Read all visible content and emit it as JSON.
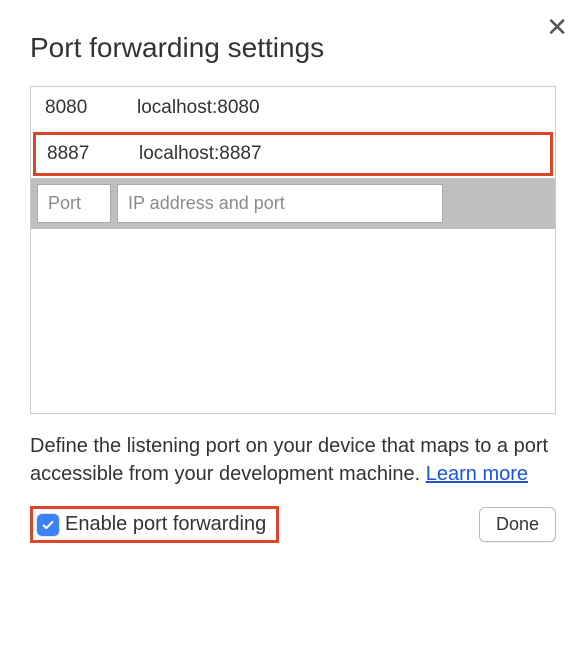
{
  "dialog": {
    "title": "Port forwarding settings",
    "rows": [
      {
        "port": "8080",
        "address": "localhost:8080",
        "highlighted": false
      },
      {
        "port": "8887",
        "address": "localhost:8887",
        "highlighted": true
      }
    ],
    "inputs": {
      "port_placeholder": "Port",
      "address_placeholder": "IP address and port"
    },
    "description": "Define the listening port on your device that maps to a port accessible from your development machine. ",
    "learn_more": "Learn more",
    "checkbox_label": "Enable port forwarding",
    "checkbox_checked": true,
    "done_label": "Done"
  }
}
